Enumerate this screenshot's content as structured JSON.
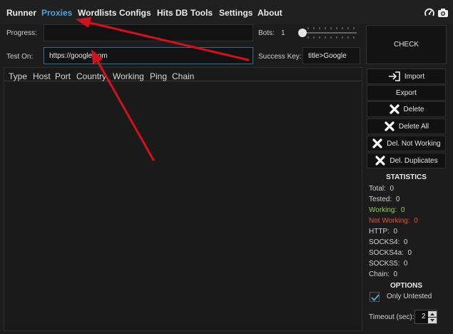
{
  "menu": {
    "items": [
      "Runner",
      "Proxies",
      "Wordlists",
      "Configs",
      "Hits DB",
      "Tools",
      "Settings",
      "About"
    ]
  },
  "top_icons": [
    "gauge-icon",
    "camera-icon"
  ],
  "form": {
    "progress_label": "Progress:",
    "progress_value": "",
    "bots_label": "Bots:",
    "bots_value": "1",
    "test_on_label": "Test On:",
    "test_on_value": "https://google.com",
    "success_key_label": "Success Key:",
    "success_key_value": "title>Google"
  },
  "check_label": "CHECK",
  "grid": {
    "columns": [
      "Type",
      "Host",
      "Port",
      "Country",
      "Working",
      "Ping",
      "Chain"
    ],
    "rows": []
  },
  "side_buttons": {
    "import": "Import",
    "export": "Export",
    "delete": "Delete",
    "delete_all": "Delete All",
    "del_not_working": "Del. Not Working",
    "del_duplicates": "Del. Duplicates"
  },
  "statistics": {
    "title": "STATISTICS",
    "total_label": "Total:",
    "total": "0",
    "tested_label": "Tested:",
    "tested": "0",
    "working_label": "Working:",
    "working": "0",
    "not_working_label": "Not Working:",
    "not_working": "0",
    "http_label": "HTTP:",
    "http": "0",
    "socks4_label": "SOCKS4:",
    "socks4": "0",
    "socks4a_label": "SOCKS4a:",
    "socks4a": "0",
    "socks5_label": "SOCKS5:",
    "socks5": "0",
    "chain_label": "Chain:",
    "chain": "0"
  },
  "options": {
    "title": "OPTIONS",
    "only_untested_label": "Only Untested",
    "only_untested_checked": true,
    "timeout_label": "Timeout (sec):",
    "timeout_value": "2"
  },
  "colors": {
    "accent": "#4aa3df",
    "working": "#8fd14f",
    "not_working": "#e2543f",
    "annotation_arrow": "#d3111b"
  }
}
